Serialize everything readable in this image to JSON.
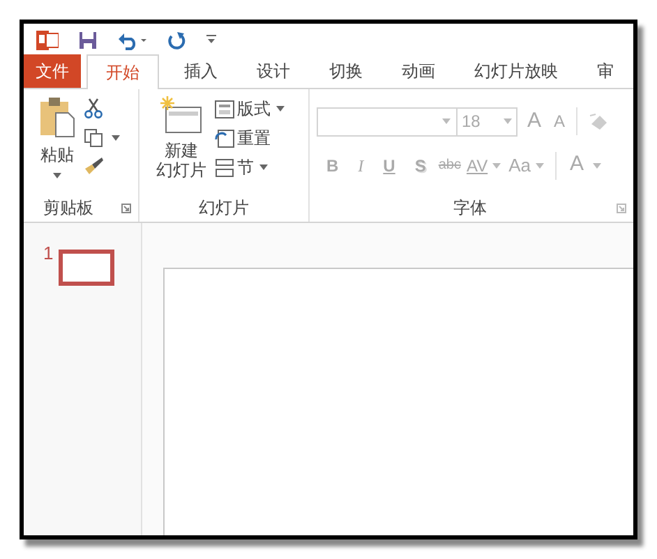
{
  "tabs": [
    {
      "label": "文件",
      "kind": "file",
      "selected": false
    },
    {
      "label": "开始",
      "kind": "tab",
      "selected": true
    },
    {
      "label": "插入",
      "kind": "tab",
      "selected": false
    },
    {
      "label": "设计",
      "kind": "tab",
      "selected": false
    },
    {
      "label": "切换",
      "kind": "tab",
      "selected": false
    },
    {
      "label": "动画",
      "kind": "tab",
      "selected": false
    },
    {
      "label": "幻灯片放映",
      "kind": "tab",
      "selected": false
    },
    {
      "label": "审",
      "kind": "tab",
      "selected": false
    }
  ],
  "clipboard": {
    "paste": "粘贴",
    "group_label": "剪贴板"
  },
  "slides_group": {
    "new_slide": [
      "新建",
      "幻灯片"
    ],
    "layout": "版式",
    "reset": "重置",
    "section": "节",
    "group_label": "幻灯片"
  },
  "font": {
    "font_size": "18",
    "grow": "A",
    "shrink": "A",
    "bold": "B",
    "italic": "I",
    "underline": "U",
    "shadow": "S",
    "strikethrough": "abc",
    "spacing": "AV",
    "change_case": "Aa",
    "font_color": "A",
    "group_label": "字体"
  },
  "thumbnails": [
    {
      "number": "1",
      "selected": true
    }
  ]
}
